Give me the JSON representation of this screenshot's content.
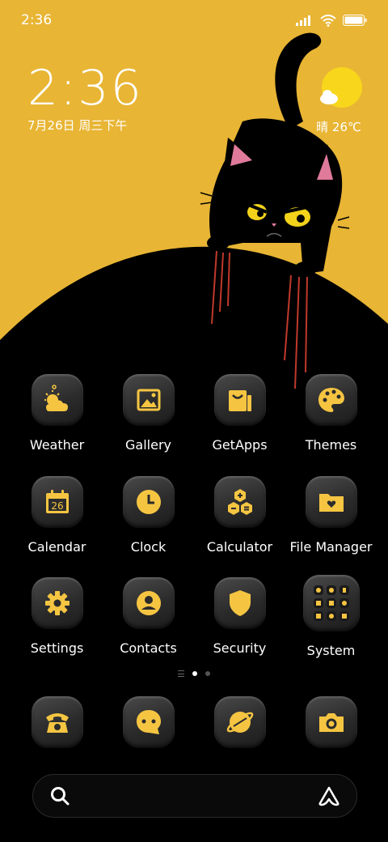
{
  "status_bar": {
    "time": "2:36"
  },
  "clock_widget": {
    "time": "2:36",
    "date": "7月26日 周三下午"
  },
  "weather_widget": {
    "temperature": "晴 26℃"
  },
  "apps": [
    {
      "label": "Weather",
      "icon": "weather-icon"
    },
    {
      "label": "Gallery",
      "icon": "gallery-icon"
    },
    {
      "label": "GetApps",
      "icon": "getapps-icon"
    },
    {
      "label": "Themes",
      "icon": "palette-icon"
    },
    {
      "label": "Calendar",
      "icon": "calendar-icon",
      "badge": "26"
    },
    {
      "label": "Clock",
      "icon": "clock-icon"
    },
    {
      "label": "Calculator",
      "icon": "calculator-icon"
    },
    {
      "label": "File Manager",
      "icon": "folder-icon"
    },
    {
      "label": "Settings",
      "icon": "gear-icon"
    },
    {
      "label": "Contacts",
      "icon": "contact-icon"
    },
    {
      "label": "Security",
      "icon": "shield-icon"
    },
    {
      "label": "System",
      "icon": "folder-grid-icon"
    }
  ],
  "dock": [
    {
      "icon": "phone-icon"
    },
    {
      "icon": "message-icon"
    },
    {
      "icon": "browser-icon"
    },
    {
      "icon": "camera-icon"
    }
  ],
  "colors": {
    "accent": "#f5c542",
    "wallpaper_yellow": "#e8b534",
    "background": "#000000"
  }
}
